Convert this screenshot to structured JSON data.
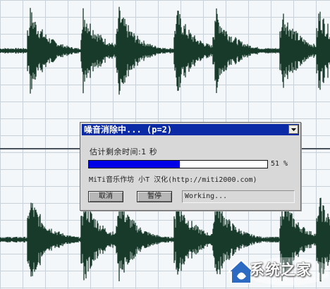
{
  "colors": {
    "waveform": "#173a2a",
    "dialog_title_bar": "#0b2aa5",
    "progress_fill": "#0000e8",
    "grid": "#c9d1d8"
  },
  "waveform_view": {
    "track_count": 2,
    "icon": "audio-waveform"
  },
  "dialog": {
    "title": "噪音消除中... (p=2)",
    "menu_icon": "chevron-down-icon",
    "remaining_time": "估计剩余时间:1 秒",
    "progress_fraction": 0.51,
    "progress_label": "51 %",
    "credit": "MiTi音乐作坊 小T 汉化(http://miti2000.com)",
    "buttons": {
      "cancel": "取消",
      "pause": "暂停"
    },
    "status": "Working..."
  },
  "watermark": {
    "text": "系统之家"
  }
}
